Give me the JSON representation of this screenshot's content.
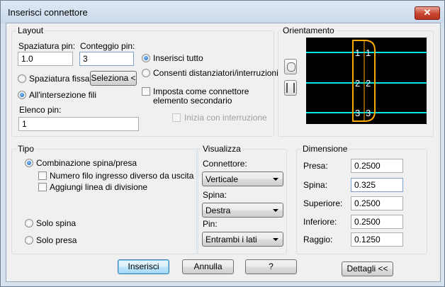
{
  "window": {
    "title": "Inserisci connettore",
    "close_label": "✕"
  },
  "layout": {
    "title": "Layout",
    "spaziatura_label": "Spaziatura pin:",
    "spaziatura_value": "1.0",
    "conteggio_label": "Conteggio pin:",
    "conteggio_value": "3",
    "radio_inserisci": "Inserisci tutto",
    "radio_consenti": "Consenti distanziatori/interruzioni",
    "radio_spaziatura_fissa": "Spaziatura fissa",
    "seleziona_button": "Seleziona <",
    "radio_intersezione": "All'intersezione fili",
    "check_imposta_line1": "Imposta come connettore",
    "check_imposta_line2": "elemento secondario",
    "check_inizia": "Inizia con interruzione",
    "elenco_label": "Elenco pin:",
    "elenco_value": "1"
  },
  "orientamento": {
    "title": "Orientamento",
    "left_labels": [
      "1",
      "2",
      "3"
    ],
    "right_labels": [
      "1",
      "2",
      "3"
    ],
    "colors": {
      "wire": "#00e5e5",
      "connector": "#ffaa00",
      "labels": "#ffffff",
      "background": "#000000"
    },
    "icons": [
      "rotate-icon",
      "flip-icon"
    ]
  },
  "tipo": {
    "title": "Tipo",
    "radio_combinazione": "Combinazione spina/presa",
    "check_numero_filo": "Numero filo ingresso diverso da uscita",
    "check_aggiungi": "Aggiungi linea di divisione",
    "radio_solo_spina": "Solo spina",
    "radio_solo_presa": "Solo presa"
  },
  "visualizza": {
    "title": "Visualizza",
    "connettore_label": "Connettore:",
    "connettore_value": "Verticale",
    "spina_label": "Spina:",
    "spina_value": "Destra",
    "pin_label": "Pin:",
    "pin_value": "Entrambi i lati"
  },
  "dimensione": {
    "title": "Dimensione",
    "presa_label": "Presa:",
    "presa_value": "0.2500",
    "spina_label": "Spina:",
    "spina_value": "0.325",
    "superiore_label": "Superiore:",
    "superiore_value": "0.2500",
    "inferiore_label": "Inferiore:",
    "inferiore_value": "0.2500",
    "raggio_label": "Raggio:",
    "raggio_value": "0.1250"
  },
  "buttons": {
    "inserisci": "Inserisci",
    "annulla": "Annulla",
    "help": "?",
    "dettagli": "Dettagli <<"
  }
}
